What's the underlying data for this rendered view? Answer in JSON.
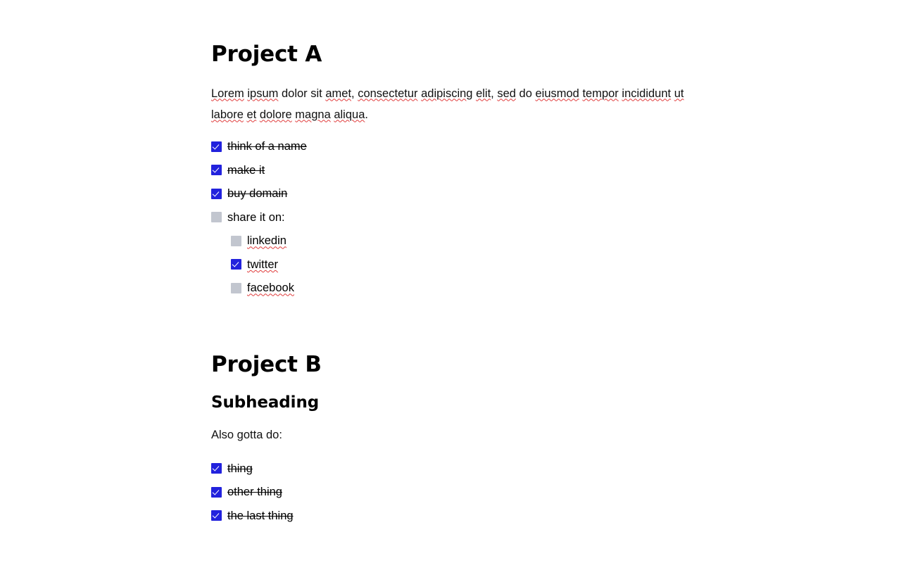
{
  "document": {
    "sections": [
      {
        "id": "project-a",
        "heading": "Project A",
        "paragraph": {
          "full_text": "Lorem ipsum dolor sit amet, consectetur adipiscing elit, sed do eiusmod tempor incididunt ut labore et dolore magna aliqua.",
          "tokens": [
            {
              "text": "Lorem",
              "spellcheck": true
            },
            {
              "text": " ",
              "spellcheck": false
            },
            {
              "text": "ipsum",
              "spellcheck": true
            },
            {
              "text": " dolor sit ",
              "spellcheck": false
            },
            {
              "text": "amet",
              "spellcheck": true
            },
            {
              "text": ", ",
              "spellcheck": false
            },
            {
              "text": "consectetur",
              "spellcheck": true
            },
            {
              "text": " ",
              "spellcheck": false
            },
            {
              "text": "adipiscing",
              "spellcheck": true
            },
            {
              "text": " ",
              "spellcheck": false
            },
            {
              "text": "elit",
              "spellcheck": true
            },
            {
              "text": ", ",
              "spellcheck": false
            },
            {
              "text": "sed",
              "spellcheck": true
            },
            {
              "text": " do ",
              "spellcheck": false
            },
            {
              "text": "eiusmod",
              "spellcheck": true
            },
            {
              "text": " ",
              "spellcheck": false
            },
            {
              "text": "tempor",
              "spellcheck": true
            },
            {
              "text": " ",
              "spellcheck": false
            },
            {
              "text": "incididunt",
              "spellcheck": true
            },
            {
              "text": " ",
              "spellcheck": false
            },
            {
              "text": "ut",
              "spellcheck": true
            },
            {
              "text": " ",
              "spellcheck": false
            },
            {
              "text": "labore",
              "spellcheck": true
            },
            {
              "text": " ",
              "spellcheck": false
            },
            {
              "text": "et",
              "spellcheck": true
            },
            {
              "text": " ",
              "spellcheck": false
            },
            {
              "text": "dolore",
              "spellcheck": true
            },
            {
              "text": " ",
              "spellcheck": false
            },
            {
              "text": "magna",
              "spellcheck": true
            },
            {
              "text": " ",
              "spellcheck": false
            },
            {
              "text": "aliqua",
              "spellcheck": true
            },
            {
              "text": ".",
              "spellcheck": false
            }
          ]
        },
        "todos": [
          {
            "label": "think of a name",
            "checked": true,
            "spellcheck": false,
            "children": []
          },
          {
            "label": "make it",
            "checked": true,
            "spellcheck": false,
            "children": []
          },
          {
            "label": "buy domain",
            "checked": true,
            "spellcheck": false,
            "children": []
          },
          {
            "label": "share it on:",
            "checked": false,
            "spellcheck": false,
            "children": [
              {
                "label": "linkedin",
                "checked": false,
                "spellcheck": true
              },
              {
                "label": "twitter",
                "checked": true,
                "spellcheck": true
              },
              {
                "label": "facebook",
                "checked": false,
                "spellcheck": true
              }
            ]
          }
        ]
      },
      {
        "id": "project-b",
        "heading": "Project B",
        "subheading": "Subheading",
        "intro": "Also gotta do:",
        "todos": [
          {
            "label": "thing",
            "checked": true,
            "spellcheck": false,
            "children": []
          },
          {
            "label": "other thing",
            "checked": true,
            "spellcheck": false,
            "children": []
          },
          {
            "label": "the last thing",
            "checked": true,
            "spellcheck": false,
            "children": []
          }
        ]
      }
    ]
  },
  "theme": {
    "background": "#ffffff",
    "text": "#000000",
    "checkbox_checked": "#2222dd",
    "checkbox_unchecked": "#c2c6cf",
    "checkmark": "#ffffff",
    "spellcheck_underline": "#e03b3b",
    "strikethrough": "#000000"
  },
  "icons": {
    "checkmark": "check-icon",
    "empty_box": "empty-checkbox-icon"
  }
}
